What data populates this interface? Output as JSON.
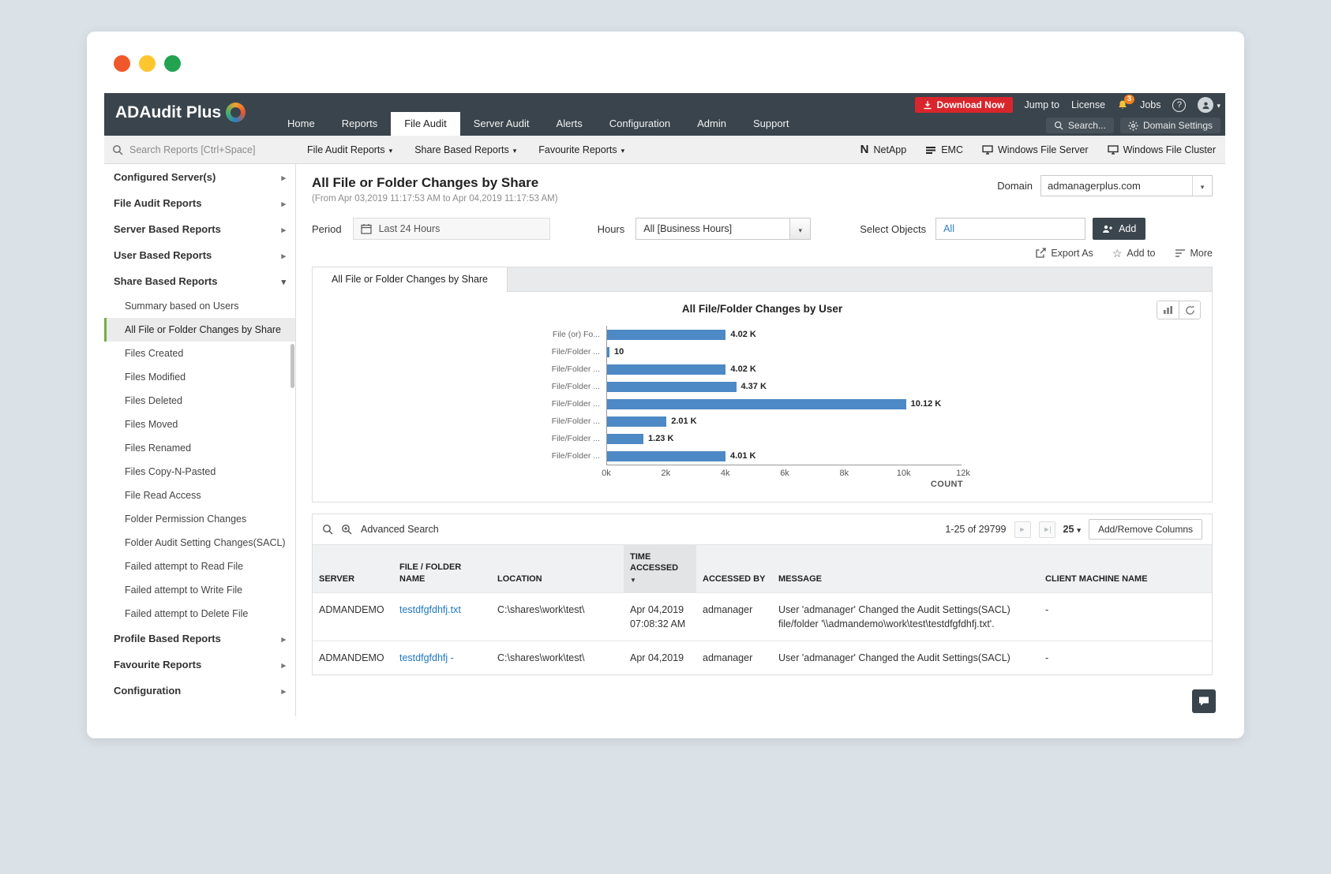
{
  "navbar": {
    "logo": "ADAudit Plus",
    "items": [
      "Home",
      "Reports",
      "File Audit",
      "Server Audit",
      "Alerts",
      "Configuration",
      "Admin",
      "Support"
    ],
    "active_item": "File Audit",
    "download_now": "Download Now",
    "jump_to": "Jump to",
    "license": "License",
    "bell_badge": "3",
    "jobs": "Jobs",
    "help": "?",
    "search_label": "Search...",
    "domain_settings": "Domain Settings"
  },
  "toolbar": {
    "search_placeholder": "Search Reports [Ctrl+Space]",
    "dropdowns": [
      "File Audit Reports",
      "Share Based Reports",
      "Favourite Reports"
    ],
    "platforms": [
      "NetApp",
      "EMC",
      "Windows File Server",
      "Windows File Cluster"
    ]
  },
  "sidebar": {
    "items": [
      {
        "label": "Configured Server(s)",
        "level": "top"
      },
      {
        "label": "File Audit Reports",
        "level": "top"
      },
      {
        "label": "Server Based Reports",
        "level": "top"
      },
      {
        "label": "User Based Reports",
        "level": "top"
      },
      {
        "label": "Share Based Reports",
        "level": "top",
        "expanded": true
      },
      {
        "label": "Summary based on Users",
        "level": "sub"
      },
      {
        "label": "All File or Folder Changes by Share",
        "level": "sub",
        "selected": true
      },
      {
        "label": "Files Created",
        "level": "sub"
      },
      {
        "label": "Files Modified",
        "level": "sub"
      },
      {
        "label": "Files Deleted",
        "level": "sub"
      },
      {
        "label": "Files Moved",
        "level": "sub"
      },
      {
        "label": "Files Renamed",
        "level": "sub"
      },
      {
        "label": "Files Copy-N-Pasted",
        "level": "sub"
      },
      {
        "label": "File Read Access",
        "level": "sub"
      },
      {
        "label": "Folder Permission Changes",
        "level": "sub"
      },
      {
        "label": "Folder Audit Setting Changes(SACL)",
        "level": "sub"
      },
      {
        "label": "Failed attempt to Read File",
        "level": "sub"
      },
      {
        "label": "Failed attempt to Write File",
        "level": "sub"
      },
      {
        "label": "Failed attempt to Delete File",
        "level": "sub"
      },
      {
        "label": "Profile Based Reports",
        "level": "top"
      },
      {
        "label": "Favourite Reports",
        "level": "top"
      },
      {
        "label": "Configuration",
        "level": "top"
      }
    ]
  },
  "main": {
    "title": "All File or Folder Changes by Share",
    "subtitle": "(From Apr 03,2019 11:17:53 AM to Apr 04,2019 11:17:53 AM)",
    "domain_label": "Domain",
    "domain_value": "admanagerplus.com",
    "filters": {
      "period_label": "Period",
      "period_value": "Last 24 Hours",
      "hours_label": "Hours",
      "hours_value": "All [Business Hours]",
      "objects_label": "Select Objects",
      "objects_value": "All",
      "add_button": "Add"
    },
    "actions": {
      "export": "Export As",
      "add_to": "Add to",
      "more": "More"
    },
    "tab": "All File or Folder Changes by Share"
  },
  "chart_data": {
    "type": "bar",
    "orientation": "horizontal",
    "title": "All File/Folder Changes by User",
    "categories": [
      "File (or) Fo...",
      "File/Folder ...",
      "File/Folder ...",
      "File/Folder ...",
      "File/Folder ...",
      "File/Folder ...",
      "File/Folder ...",
      "File/Folder ..."
    ],
    "values": [
      4020,
      10,
      4020,
      4370,
      10120,
      2010,
      1230,
      4010
    ],
    "value_labels": [
      "4.02 K",
      "10",
      "4.02 K",
      "4.37 K",
      "10.12 K",
      "2.01 K",
      "1.23 K",
      "4.01 K"
    ],
    "x_ticks": [
      "0k",
      "2k",
      "4k",
      "6k",
      "8k",
      "10k",
      "12k"
    ],
    "xlim": [
      0,
      12000
    ],
    "xlabel": "COUNT",
    "bar_color": "#4d89c5",
    "legend": "none",
    "grid": false
  },
  "table": {
    "advanced_search": "Advanced Search",
    "pagination": "1-25 of 29799",
    "page_size": "25",
    "add_remove_columns": "Add/Remove Columns",
    "columns": [
      "SERVER",
      "FILE / FOLDER NAME",
      "LOCATION",
      "TIME ACCESSED",
      "ACCESSED BY",
      "MESSAGE",
      "CLIENT MACHINE NAME"
    ],
    "sorted_column": "TIME ACCESSED",
    "rows": [
      {
        "server": "ADMANDEMO",
        "file": "testdfgfdhfj.txt",
        "location": "C:\\shares\\work\\test\\",
        "time": "Apr 04,2019 07:08:32 AM",
        "by": "admanager",
        "message": "User 'admanager' Changed the Audit Settings(SACL) file/folder '\\\\admandemo\\work\\test\\testdfgfdhfj.txt'.",
        "client": "-"
      },
      {
        "server": "ADMANDEMO",
        "file": "testdfgfdhfj -",
        "location": "C:\\shares\\work\\test\\",
        "time": "Apr 04,2019",
        "by": "admanager",
        "message": "User 'admanager' Changed the Audit Settings(SACL)",
        "client": "-"
      }
    ]
  }
}
